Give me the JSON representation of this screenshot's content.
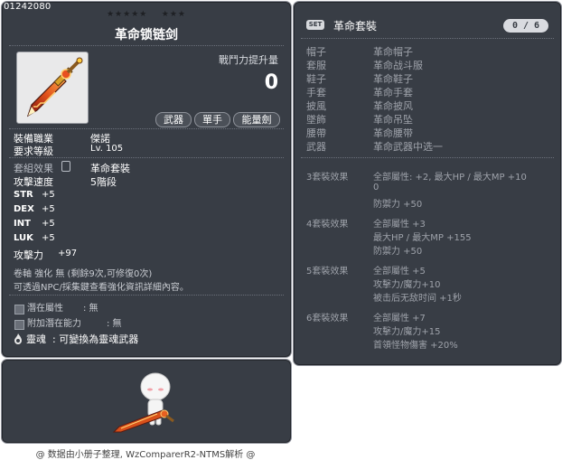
{
  "item": {
    "id": "01242080",
    "stars_left": "★★★★★",
    "stars_right": "★★★",
    "name": "革命锁链剑",
    "combat_power_label": "戰鬥力提升量",
    "combat_power_value": "0",
    "tags": [
      "武器",
      "單手",
      "能量劍"
    ],
    "job_label": "裝備職業",
    "job_value": "傑諾",
    "req_level_label": "要求等級",
    "req_level_value": "Lv. 105",
    "set_effect_label": "套組效果",
    "set_effect_value": "革命套裝",
    "attack_speed_label": "攻擊速度",
    "attack_speed_value": "5階段",
    "stats": [
      {
        "name": "STR",
        "value": "+5"
      },
      {
        "name": "DEX",
        "value": "+5"
      },
      {
        "name": "INT",
        "value": "+5"
      },
      {
        "name": "LUK",
        "value": "+5"
      }
    ],
    "attack_label": "攻擊力",
    "attack_value": "+97",
    "scroll_text": "卷軸 強化 無 (剩餘9次,可修復0次)",
    "scroll_note": "可透過NPC/採集鍵查看強化資訊詳細內容。",
    "potential_label": "潛在屬性",
    "potential_value": ": 無",
    "add_potential_label": "附加潛在能力",
    "add_potential_value": ": 無",
    "soul_label": "靈魂",
    "soul_value": ": 可變換為靈魂武器"
  },
  "set": {
    "badge": "SET",
    "name": "革命套裝",
    "count": "0 / 6",
    "parts": [
      {
        "slot": "帽子",
        "name": "革命帽子"
      },
      {
        "slot": "套服",
        "name": "革命战斗服"
      },
      {
        "slot": "鞋子",
        "name": "革命鞋子"
      },
      {
        "slot": "手套",
        "name": "革命手套"
      },
      {
        "slot": "披風",
        "name": "革命披风"
      },
      {
        "slot": "墜飾",
        "name": "革命吊坠"
      },
      {
        "slot": "腰帶",
        "name": "革命腰带"
      },
      {
        "slot": "武器",
        "name": "革命武器中选一"
      }
    ],
    "effects": [
      {
        "label": "3套裝效果",
        "lines": [
          "全部屬性: +2, 最大HP / 最大MP  +10",
          "0",
          "防禦力  +50"
        ]
      },
      {
        "label": "4套裝效果",
        "lines": [
          "全部屬性 +3",
          "最大HP / 最大MP  +155",
          "防禦力  +50"
        ]
      },
      {
        "label": "5套裝效果",
        "lines": [
          "全部屬性 +5",
          "攻擊力/魔力+10",
          "被击后无敌时间 +1秒"
        ]
      },
      {
        "label": "6套裝效果",
        "lines": [
          "全部屬性 +7",
          "攻擊力/魔力+15",
          "首領怪物傷害 +20%"
        ]
      }
    ]
  },
  "credit": "@ 数据由小册子整理, WzComparerR2-NTMS解析 @"
}
